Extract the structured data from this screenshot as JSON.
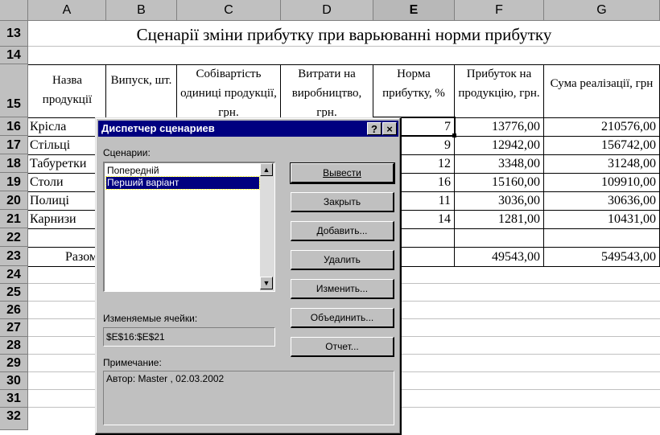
{
  "columns": [
    "A",
    "B",
    "C",
    "D",
    "E",
    "F",
    "G"
  ],
  "rows": [
    "13",
    "14",
    "15",
    "16",
    "17",
    "18",
    "19",
    "20",
    "21",
    "22",
    "23",
    "24",
    "25",
    "26",
    "27",
    "28",
    "29",
    "30",
    "31",
    "32"
  ],
  "sheet": {
    "title": "Сценарії зміни прибутку при варьюванні норми прибутку",
    "headers": {
      "a": "Назва продукції",
      "b": "Випуск, шт.",
      "c": "Собівартість одиниці продукції, грн.",
      "d": "Витрати на виробництво, грн.",
      "e": "Норма прибутку, %",
      "f": "Прибуток на продукцію, грн.",
      "g": "Сума реалізації, грн"
    },
    "data_rows": [
      {
        "name": "Крісла",
        "e": "7",
        "f": "13776,00",
        "g": "210576,00"
      },
      {
        "name": "Стільці",
        "e": "9",
        "f": "12942,00",
        "g": "156742,00"
      },
      {
        "name": "Табуретки",
        "e": "12",
        "f": "3348,00",
        "g": "31248,00"
      },
      {
        "name": "Столи",
        "e": "16",
        "f": "15160,00",
        "g": "109910,00"
      },
      {
        "name": "Полиці",
        "e": "11",
        "f": "3036,00",
        "g": "30636,00"
      },
      {
        "name": "Карнизи",
        "e": "14",
        "f": "1281,00",
        "g": "10431,00"
      }
    ],
    "total": {
      "label": "Разом",
      "f": "49543,00",
      "g": "549543,00"
    }
  },
  "dialog": {
    "title": "Диспетчер сценариев",
    "help": "?",
    "close": "×",
    "scenarios_label": "Сценарии:",
    "scenarios": [
      "Попередній",
      "Перший варіант"
    ],
    "selected_index": 1,
    "buttons": {
      "show": "Вывести",
      "close": "Закрыть",
      "add": "Добавить...",
      "delete": "Удалить",
      "edit": "Изменить...",
      "merge": "Объединить...",
      "report": "Отчет..."
    },
    "changing_cells_label": "Изменяемые ячейки:",
    "changing_cells": "$E$16:$E$21",
    "comment_label": "Примечание:",
    "comment": "Автор: Master , 02.03.2002"
  }
}
